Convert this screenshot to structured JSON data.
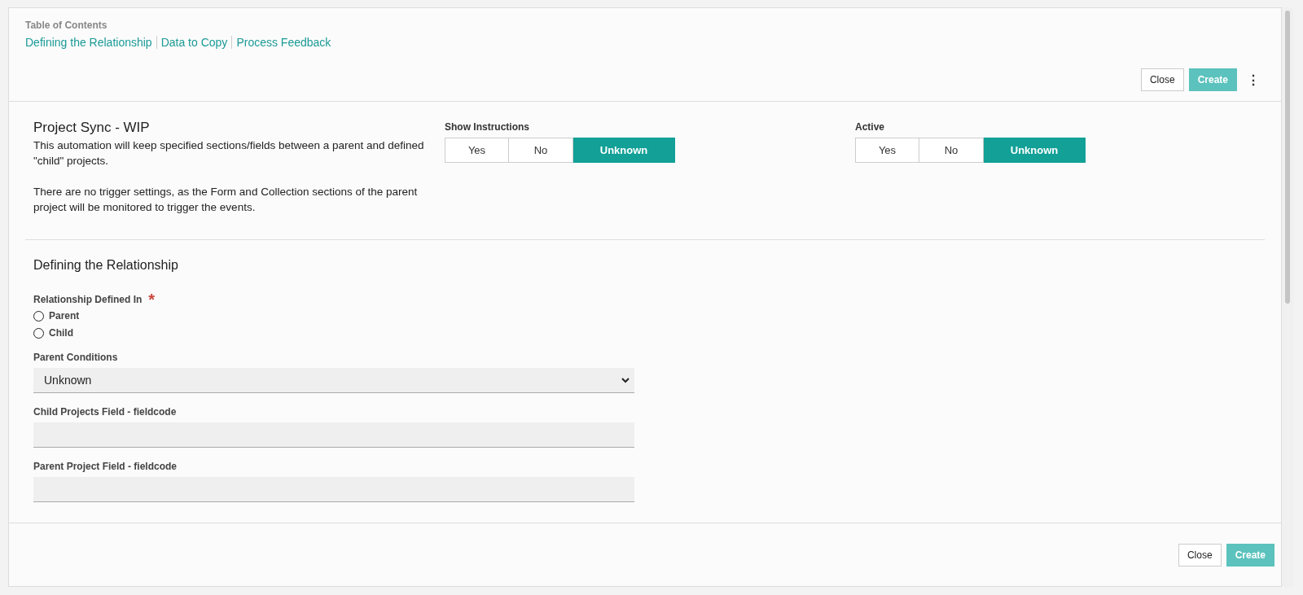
{
  "toc": {
    "title": "Table of Contents",
    "links": [
      "Defining the Relationship",
      "Data to Copy",
      "Process Feedback"
    ]
  },
  "header_actions": {
    "close": "Close",
    "create": "Create",
    "more": "⋮"
  },
  "automation": {
    "title": "Project Sync - WIP",
    "paragraphs": [
      "This automation will keep specified sections/fields between a parent and defined \"child\" projects.",
      "There are no trigger settings, as the Form and Collection sections of the parent project will be monitored to trigger the events."
    ]
  },
  "toggles": [
    {
      "label": "Show Instructions",
      "options": [
        {
          "label": "Yes",
          "selected": false
        },
        {
          "label": "No",
          "selected": false
        },
        {
          "label": "Unknown",
          "selected": true
        }
      ]
    },
    {
      "label": "Active",
      "options": [
        {
          "label": "Yes",
          "selected": false
        },
        {
          "label": "No",
          "selected": false
        },
        {
          "label": "Unknown",
          "selected": true
        }
      ]
    }
  ],
  "section": {
    "title": "Defining the Relationship",
    "fields": [
      {
        "kind": "radio",
        "label": "Relationship Defined In",
        "required_mark": "*",
        "options": [
          {
            "label": "Parent",
            "selected": false
          },
          {
            "label": "Child",
            "selected": false
          }
        ]
      },
      {
        "kind": "select",
        "label": "Parent Conditions",
        "value": "Unknown"
      },
      {
        "kind": "text",
        "label": "Child Projects Field - fieldcode"
      },
      {
        "kind": "text",
        "label": "Parent Project Field - fieldcode"
      }
    ]
  },
  "footer_actions": {
    "close": "Close",
    "create": "Create"
  }
}
